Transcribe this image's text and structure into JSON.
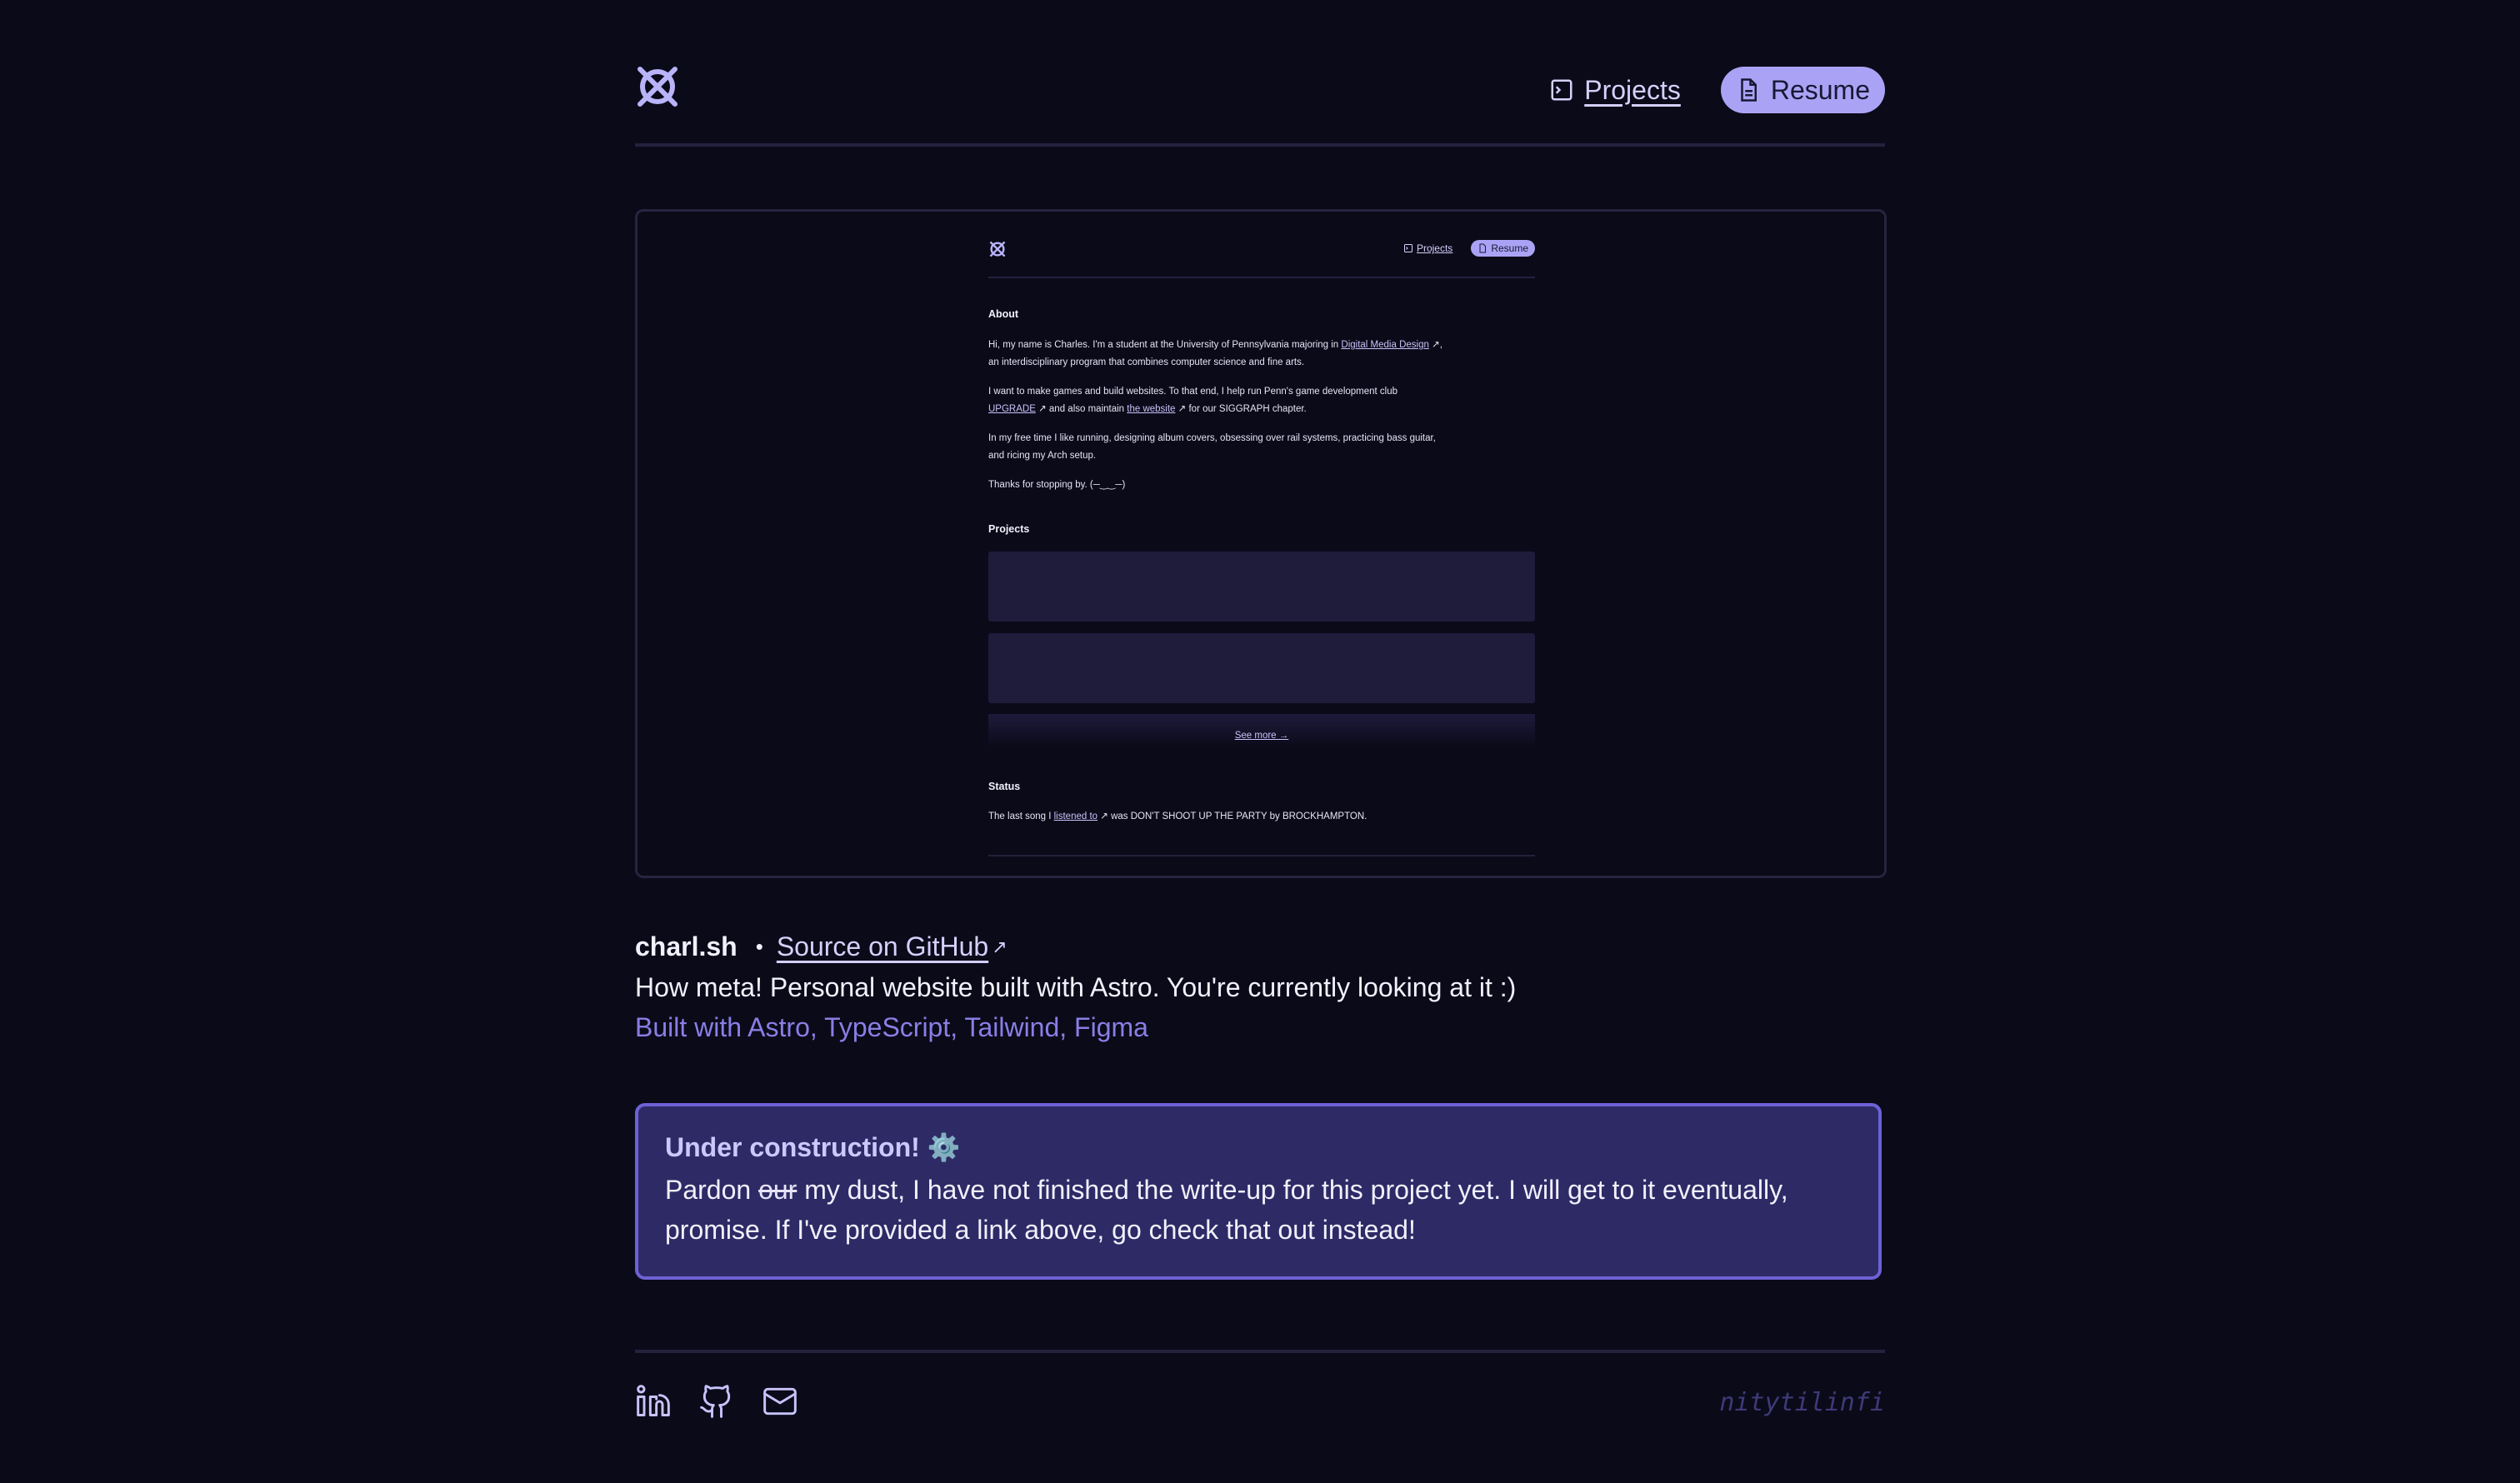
{
  "nav": {
    "projects_label": "Projects",
    "resume_label": "Resume"
  },
  "preview": {
    "nav_projects": "Projects",
    "nav_resume": "Resume",
    "about_heading": "About",
    "about_p1_a": "Hi, my name is Charles. I'm a student at the University of Pennsylvania majoring in ",
    "about_p1_link": "Digital Media Design",
    "about_p1_b": ",",
    "about_p1_c": "an interdisciplinary program that combines computer science and fine arts.",
    "about_p2_a": "I want to make games and build websites. To that end, I help run Penn's game development club",
    "about_p2_link1": "UPGRADE",
    "about_p2_b": " and also maintain ",
    "about_p2_link2": "the website",
    "about_p2_c": " for our SIGGRAPH chapter.",
    "about_p3_a": "In my free time I like running, designing album covers, obsessing over rail systems, practicing bass guitar,",
    "about_p3_b": "and ricing my Arch setup.",
    "about_p4": "Thanks for stopping by. (─‿‿─)",
    "projects_heading": "Projects",
    "see_more": "See more →",
    "status_heading": "Status",
    "status_a": "The last song I ",
    "status_link": "listened to",
    "status_b": " was DON'T SHOOT UP THE PARTY by BROCKHAMPTON."
  },
  "project": {
    "name": "charl.sh",
    "separator": "•",
    "source_label": "Source on GitHub",
    "description": "How meta! Personal website built with Astro. You're currently looking at it :)",
    "tech": "Built with Astro, TypeScript, Tailwind, Figma"
  },
  "callout": {
    "title": "Under construction! ⚙️",
    "body_a": "Pardon ",
    "body_strike": "our",
    "body_b": " my dust, I have not finished the write-up for this project yet. I will get to it eventually, promise. If I've provided a link above, go check that out instead!"
  },
  "footer": {
    "handle": "nitytilinfi"
  },
  "colors": {
    "background": "#0b0a19",
    "accent": "#aaa3f5",
    "callout_bg": "#2e2a66",
    "callout_border": "#6d61d6",
    "tech_text": "#8a7ee6"
  }
}
